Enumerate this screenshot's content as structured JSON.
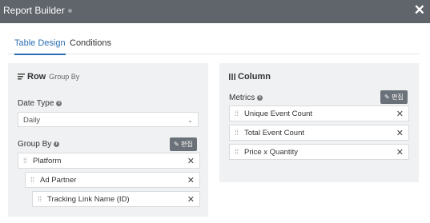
{
  "window": {
    "title": "Report Builder",
    "close_glyph": "✕"
  },
  "tabs": [
    {
      "label": "Table Design",
      "active": true
    },
    {
      "label": "Conditions",
      "active": false
    }
  ],
  "row_panel": {
    "title": "Row",
    "subtitle": "Group By",
    "date_type_label": "Date Type",
    "date_type_value": "Daily",
    "group_by_label": "Group By",
    "edit_label": "편집",
    "items": [
      {
        "label": "Platform"
      },
      {
        "label": "Ad Partner"
      },
      {
        "label": "Tracking Link Name (ID)"
      }
    ]
  },
  "column_panel": {
    "title": "Column",
    "metrics_label": "Metrics",
    "edit_label": "편집",
    "items": [
      {
        "label": "Unique Event Count"
      },
      {
        "label": "Total Event Count"
      },
      {
        "label": "Price x Quantity"
      }
    ]
  },
  "colors": {
    "titlebar": "#5f656b",
    "accent": "#2d6fb5",
    "panel": "#f0f1f2"
  }
}
